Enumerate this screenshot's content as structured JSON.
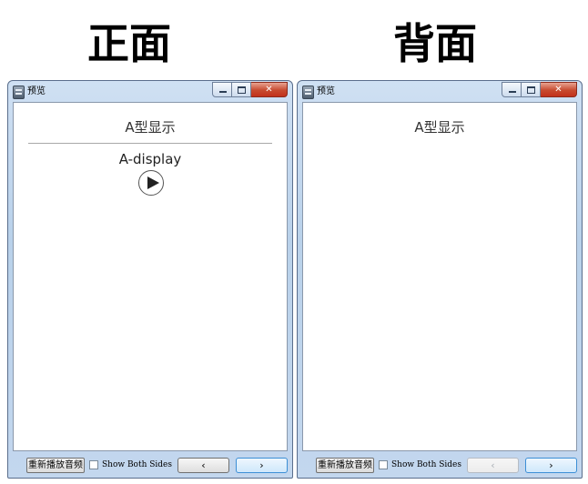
{
  "headings": {
    "front": "正面",
    "back": "背面"
  },
  "front_window": {
    "title": "预览",
    "card_title": "A型显示",
    "answer": "A-display",
    "replay_label": "重新播放音频",
    "checkbox_label": "Show Both Sides",
    "prev_label": "‹",
    "next_label": "›"
  },
  "back_window": {
    "title": "预览",
    "card_title": "A型显示",
    "replay_label": "重新播放音频",
    "checkbox_label": "Show Both Sides",
    "prev_label": "‹",
    "next_label": "›"
  }
}
